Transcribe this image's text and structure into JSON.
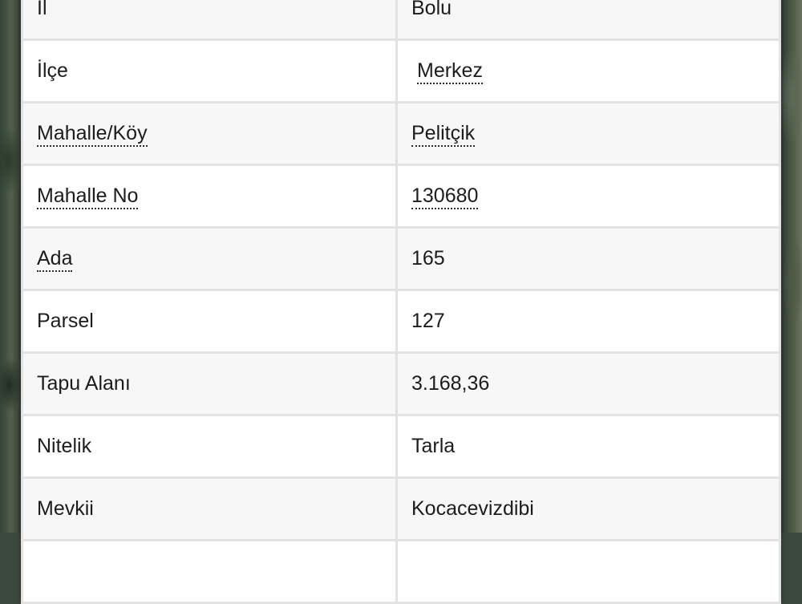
{
  "rows": [
    {
      "label": "İl",
      "value": "Bolu",
      "label_link": false,
      "value_link": false
    },
    {
      "label": "İlçe",
      "value": "Merkez",
      "label_link": false,
      "value_link": true
    },
    {
      "label": "Mahalle/Köy",
      "value": "Pelitçik",
      "label_link": true,
      "value_link": true
    },
    {
      "label": "Mahalle No",
      "value": "130680",
      "label_link": true,
      "value_link": true
    },
    {
      "label": "Ada",
      "value": "165",
      "label_link": true,
      "value_link": false
    },
    {
      "label": "Parsel",
      "value": "127",
      "label_link": false,
      "value_link": false
    },
    {
      "label": "Tapu Alanı",
      "value": "3.168,36",
      "label_link": false,
      "value_link": false
    },
    {
      "label": "Nitelik",
      "value": "Tarla",
      "label_link": false,
      "value_link": false
    },
    {
      "label": "Mevkii",
      "value": "Kocacevizdibi",
      "label_link": false,
      "value_link": false
    },
    {
      "label": "",
      "value": "",
      "label_link": false,
      "value_link": false
    }
  ]
}
